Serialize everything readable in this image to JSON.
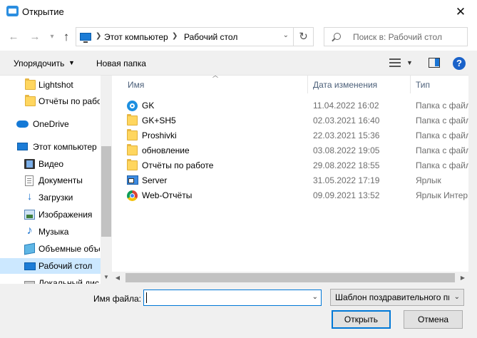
{
  "window": {
    "title": "Открытие",
    "close_glyph": "✕"
  },
  "navbar": {
    "breadcrumbs": [
      "Этот компьютер",
      "Рабочий стол"
    ],
    "search_placeholder": "Поиск в: Рабочий стол"
  },
  "toolbar": {
    "organize_label": "Упорядочить",
    "new_folder_label": "Новая папка",
    "help_label": "?"
  },
  "sidebar": {
    "items": [
      {
        "label": "Lightshot",
        "icon": "folder-icon"
      },
      {
        "label": "Отчёты по работе",
        "icon": "folder-icon"
      },
      {
        "label": "OneDrive",
        "icon": "onedrive-icon"
      },
      {
        "label": "Этот компьютер",
        "icon": "computer-icon"
      },
      {
        "label": "Видео",
        "icon": "video-icon"
      },
      {
        "label": "Документы",
        "icon": "documents-icon"
      },
      {
        "label": "Загрузки",
        "icon": "downloads-icon"
      },
      {
        "label": "Изображения",
        "icon": "pictures-icon"
      },
      {
        "label": "Музыка",
        "icon": "music-icon"
      },
      {
        "label": "Объемные объекты",
        "icon": "3d-objects-icon"
      },
      {
        "label": "Рабочий стол",
        "icon": "desktop-icon",
        "selected": true
      },
      {
        "label": "Локальный диск",
        "icon": "disk-icon"
      }
    ]
  },
  "file_list": {
    "columns": [
      "Имя",
      "Дата изменения",
      "Тип"
    ],
    "rows": [
      {
        "name": "GK",
        "date": "11.04.2022 16:02",
        "type": "Папка с файлами",
        "icon": "gk-folder-icon"
      },
      {
        "name": "GK+SH5",
        "date": "02.03.2021 16:40",
        "type": "Папка с файлами",
        "icon": "folder-icon"
      },
      {
        "name": "Proshivki",
        "date": "22.03.2021 15:36",
        "type": "Папка с файлами",
        "icon": "folder-icon"
      },
      {
        "name": "обновление",
        "date": "03.08.2022 19:05",
        "type": "Папка с файлами",
        "icon": "folder-icon"
      },
      {
        "name": "Отчёты по работе",
        "date": "29.08.2022 18:55",
        "type": "Папка с файлами",
        "icon": "folder-icon"
      },
      {
        "name": "Server",
        "date": "31.05.2022 17:19",
        "type": "Ярлык",
        "icon": "shortcut-icon"
      },
      {
        "name": "Web-Отчёты",
        "date": "09.09.2021 13:52",
        "type": "Ярлык Интернета",
        "icon": "chrome-icon"
      }
    ]
  },
  "bottom": {
    "filename_label": "Имя файла:",
    "filename_value": "",
    "filter_value": "Шаблон поздравительного письма",
    "open_label": "Открыть",
    "cancel_label": "Отмена"
  }
}
